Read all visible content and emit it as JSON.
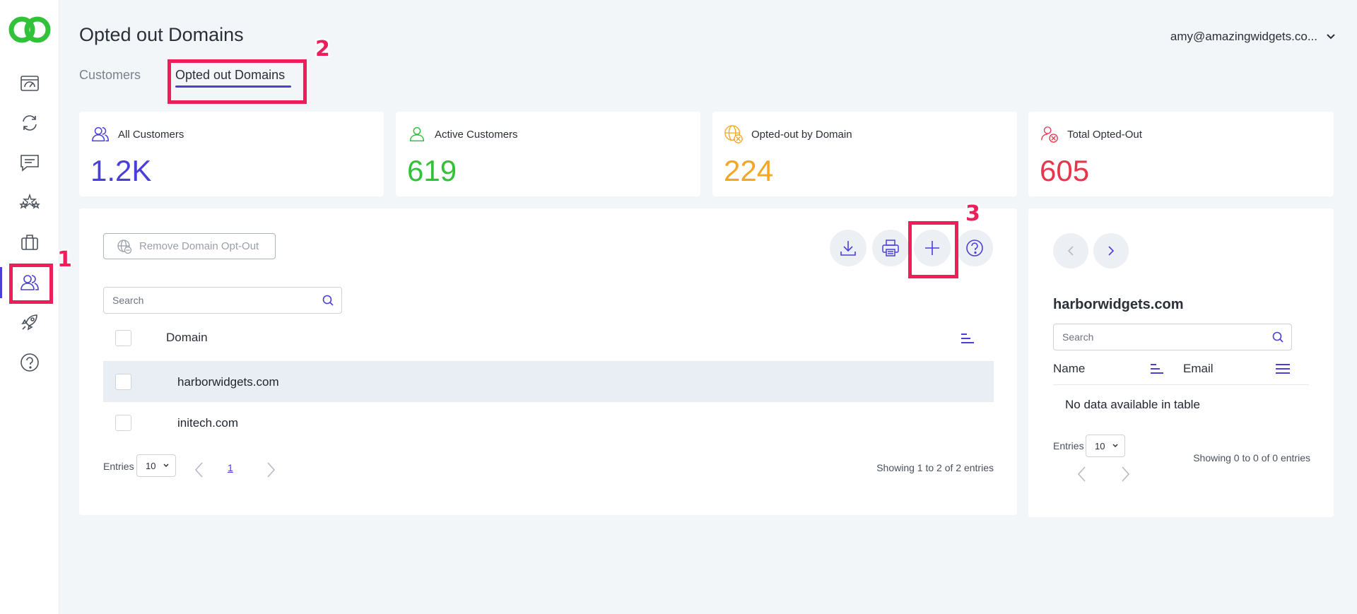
{
  "header": {
    "title": "Opted out Domains",
    "user_email": "amy@amazingwidgets.co..."
  },
  "tabs": [
    {
      "label": "Customers",
      "active": false
    },
    {
      "label": "Opted out Domains",
      "active": true
    }
  ],
  "sidebar": {
    "items": [
      {
        "icon": "dashboard-icon"
      },
      {
        "icon": "sync-icon"
      },
      {
        "icon": "chat-icon"
      },
      {
        "icon": "stars-icon"
      },
      {
        "icon": "briefcase-icon"
      },
      {
        "icon": "customers-icon",
        "active": true
      },
      {
        "icon": "rocket-icon"
      },
      {
        "icon": "help-icon"
      }
    ]
  },
  "stats": [
    {
      "label": "All Customers",
      "value": "1.2K",
      "color": "#4a3fd8"
    },
    {
      "label": "Active Customers",
      "value": "619",
      "color": "#31c23a"
    },
    {
      "label": "Opted-out by Domain",
      "value": "224",
      "color": "#f5a623"
    },
    {
      "label": "Total Opted-Out",
      "value": "605",
      "color": "#e8354c"
    }
  ],
  "toolbar": {
    "remove_label": "Remove Domain Opt-Out"
  },
  "table": {
    "search_placeholder": "Search",
    "column_domain": "Domain",
    "rows": [
      {
        "domain": "harborwidgets.com",
        "highlighted": true
      },
      {
        "domain": "initech.com",
        "highlighted": false
      }
    ],
    "entries_label": "Entries",
    "entries_value": "10",
    "current_page": "1",
    "showing": "Showing 1 to 2 of 2 entries"
  },
  "detail": {
    "title": "harborwidgets.com",
    "search_placeholder": "Search",
    "col_name": "Name",
    "col_email": "Email",
    "empty": "No data available in table",
    "entries_label": "Entries",
    "entries_value": "10",
    "showing": "Showing 0 to 0 of 0 entries"
  },
  "annotations": [
    "1",
    "2",
    "3"
  ],
  "colors": {
    "accent": "#4a3fd8",
    "annotation": "#ee1e5a",
    "logo": "#31c23a"
  }
}
